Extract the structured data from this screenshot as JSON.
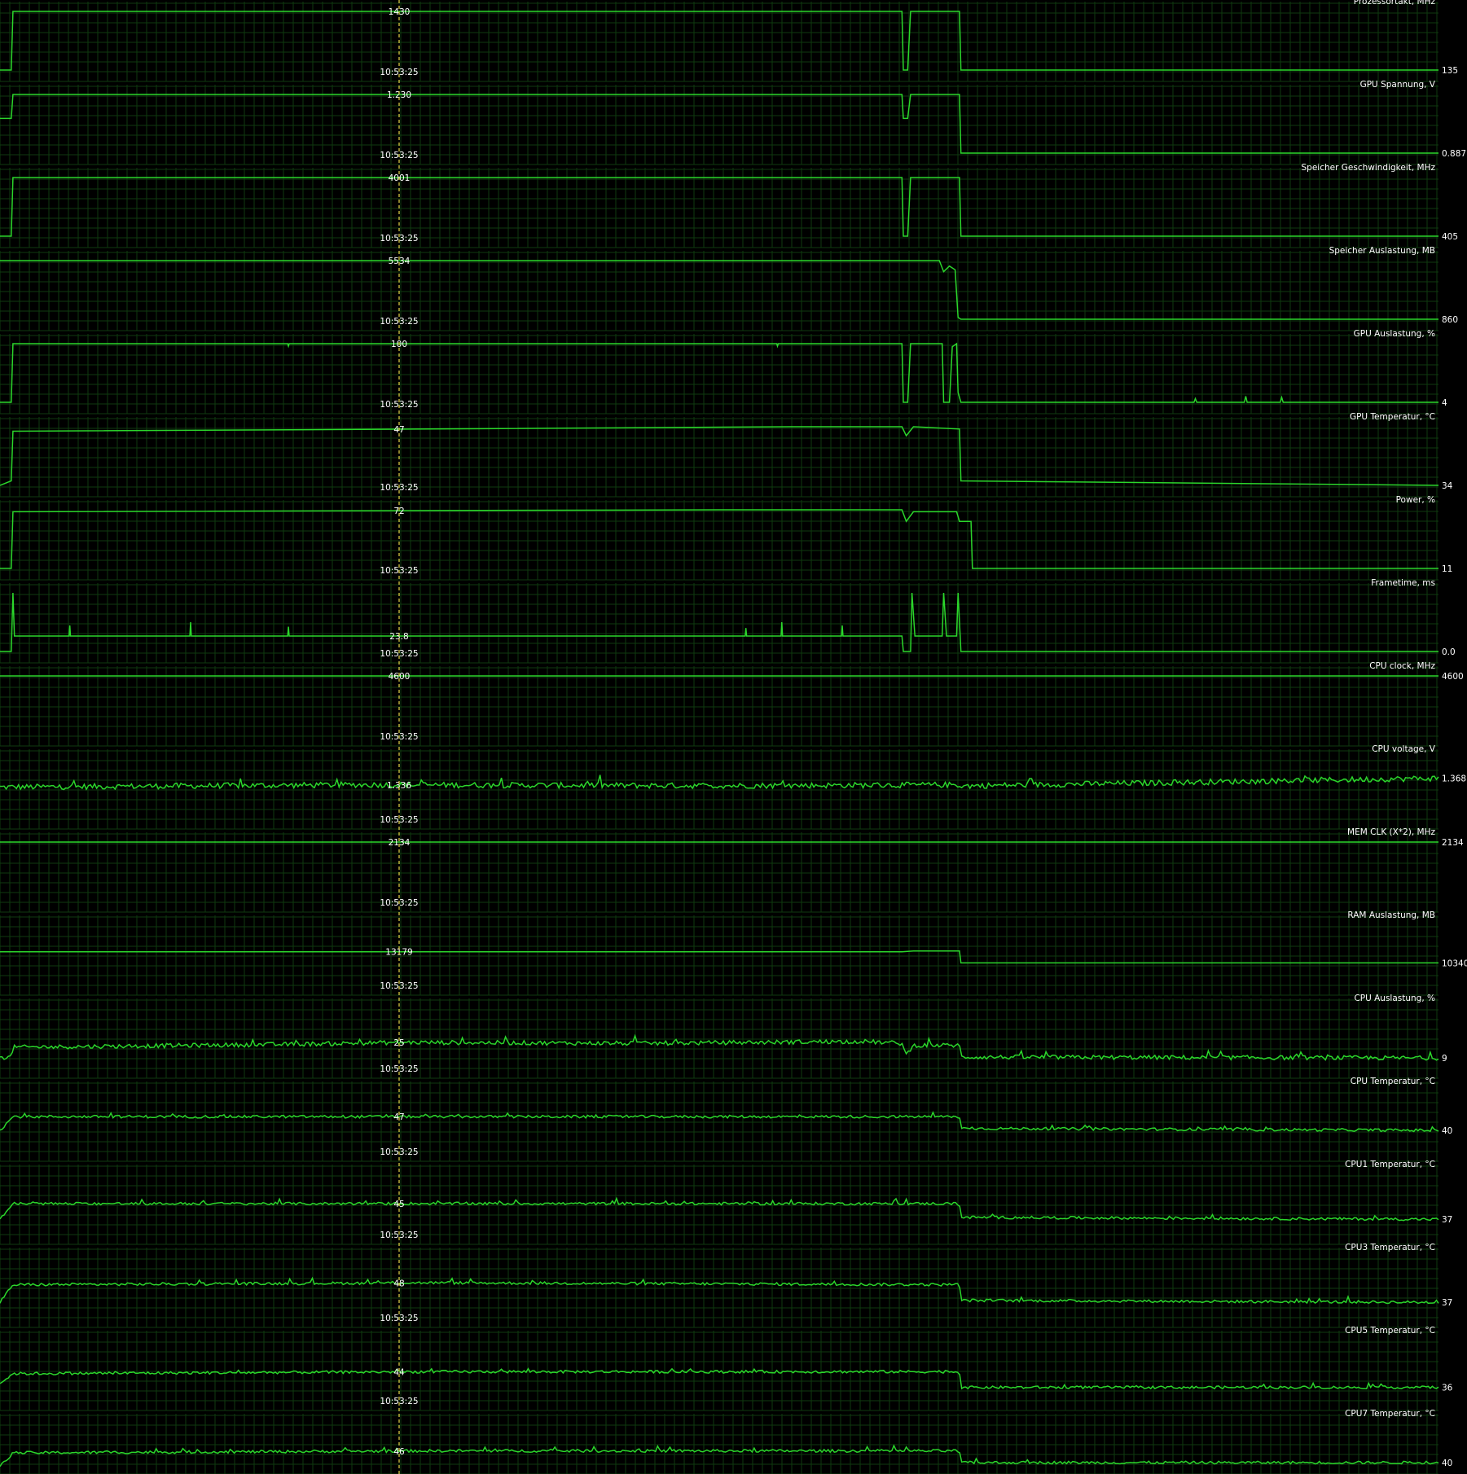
{
  "cursor_time": "10:53:25",
  "colors": {
    "background": "#000000",
    "grid": "#0f3a0f",
    "line": "#2bd62b",
    "text": "#ffffff",
    "cursor": "#e8d84a"
  },
  "panels": [
    {
      "title": "Prozessortakt, MHz",
      "cursor_value": "1430",
      "current_value": "135",
      "ylim": [
        135,
        1430
      ],
      "series": [
        [
          0,
          135
        ],
        [
          0.0078,
          135
        ],
        [
          0.009,
          1430
        ],
        [
          0.627,
          1430
        ],
        [
          0.628,
          135
        ],
        [
          0.631,
          135
        ],
        [
          0.633,
          1430
        ],
        [
          0.667,
          1430
        ],
        [
          0.668,
          135
        ],
        [
          1,
          135
        ]
      ]
    },
    {
      "title": "GPU Spannung, V",
      "cursor_value": "1.230",
      "current_value": "0.887",
      "ylim": [
        0.887,
        1.23
      ],
      "series": [
        [
          0,
          1.09
        ],
        [
          0.0078,
          1.09
        ],
        [
          0.009,
          1.23
        ],
        [
          0.627,
          1.23
        ],
        [
          0.628,
          1.09
        ],
        [
          0.631,
          1.09
        ],
        [
          0.633,
          1.23
        ],
        [
          0.667,
          1.23
        ],
        [
          0.668,
          0.887
        ],
        [
          1,
          0.887
        ]
      ]
    },
    {
      "title": "Speicher Geschwindigkeit, MHz",
      "cursor_value": "4001",
      "current_value": "405",
      "ylim": [
        405,
        4001
      ],
      "series": [
        [
          0,
          405
        ],
        [
          0.0078,
          405
        ],
        [
          0.009,
          4001
        ],
        [
          0.627,
          4001
        ],
        [
          0.628,
          405
        ],
        [
          0.631,
          405
        ],
        [
          0.633,
          4001
        ],
        [
          0.667,
          4001
        ],
        [
          0.668,
          405
        ],
        [
          1,
          405
        ]
      ]
    },
    {
      "title": "Speicher Auslastung, MB",
      "cursor_value": "5534",
      "current_value": "860",
      "ylim": [
        860,
        5534
      ],
      "series": [
        [
          0,
          5534
        ],
        [
          0.653,
          5534
        ],
        [
          0.656,
          4650
        ],
        [
          0.66,
          5100
        ],
        [
          0.664,
          4800
        ],
        [
          0.666,
          1000
        ],
        [
          0.668,
          860
        ],
        [
          1,
          860
        ]
      ]
    },
    {
      "title": "GPU Auslastung, %",
      "cursor_value": "100",
      "current_value": "4",
      "ylim": [
        4,
        100
      ],
      "series": [
        [
          0,
          4
        ],
        [
          0.0078,
          4
        ],
        [
          0.009,
          100
        ],
        [
          0.2,
          100
        ],
        [
          0.2005,
          96
        ],
        [
          0.201,
          100
        ],
        [
          0.54,
          100
        ],
        [
          0.5405,
          96
        ],
        [
          0.541,
          100
        ],
        [
          0.627,
          100
        ],
        [
          0.628,
          4
        ],
        [
          0.631,
          4
        ],
        [
          0.633,
          100
        ],
        [
          0.655,
          100
        ],
        [
          0.656,
          4
        ],
        [
          0.66,
          4
        ],
        [
          0.662,
          95
        ],
        [
          0.665,
          100
        ],
        [
          0.666,
          20
        ],
        [
          0.668,
          4
        ],
        [
          0.7,
          4
        ],
        [
          0.83,
          4
        ],
        [
          0.831,
          10
        ],
        [
          0.832,
          4
        ],
        [
          0.865,
          4
        ],
        [
          0.866,
          14
        ],
        [
          0.867,
          4
        ],
        [
          0.89,
          4
        ],
        [
          0.891,
          12
        ],
        [
          0.892,
          4
        ],
        [
          1,
          4
        ]
      ]
    },
    {
      "title": "GPU Temperatur, °C",
      "cursor_value": "47",
      "current_value": "34",
      "ylim": [
        34,
        47
      ],
      "series": [
        [
          0,
          34
        ],
        [
          0.0078,
          35
        ],
        [
          0.009,
          46
        ],
        [
          0.3,
          46.5
        ],
        [
          0.55,
          47
        ],
        [
          0.627,
          47
        ],
        [
          0.63,
          45
        ],
        [
          0.635,
          47
        ],
        [
          0.667,
          46.5
        ],
        [
          0.668,
          35
        ],
        [
          1,
          34
        ]
      ]
    },
    {
      "title": "Power, %",
      "cursor_value": "72",
      "current_value": "11",
      "ylim": [
        11,
        72
      ],
      "series": [
        [
          0,
          11
        ],
        [
          0.0078,
          11
        ],
        [
          0.009,
          70
        ],
        [
          0.5,
          72
        ],
        [
          0.627,
          72
        ],
        [
          0.63,
          60
        ],
        [
          0.635,
          70
        ],
        [
          0.665,
          70
        ],
        [
          0.667,
          60
        ],
        [
          0.675,
          60
        ],
        [
          0.676,
          11
        ],
        [
          1,
          11
        ]
      ]
    },
    {
      "title": "Frametime, ms",
      "cursor_value": "23.8",
      "current_value": "0.0",
      "ylim": [
        0,
        90
      ],
      "series": [
        [
          0,
          0
        ],
        [
          0.0078,
          0
        ],
        [
          0.009,
          90
        ],
        [
          0.01,
          23.8
        ],
        [
          0.048,
          23.8
        ],
        [
          0.0485,
          40
        ],
        [
          0.049,
          23.8
        ],
        [
          0.132,
          23.8
        ],
        [
          0.1325,
          45
        ],
        [
          0.133,
          23.8
        ],
        [
          0.2,
          23.8
        ],
        [
          0.2005,
          38
        ],
        [
          0.201,
          23.8
        ],
        [
          0.518,
          23.8
        ],
        [
          0.5185,
          36
        ],
        [
          0.519,
          23.8
        ],
        [
          0.543,
          23.8
        ],
        [
          0.5435,
          45
        ],
        [
          0.544,
          23.8
        ],
        [
          0.585,
          23.8
        ],
        [
          0.5855,
          40
        ],
        [
          0.586,
          23.8
        ],
        [
          0.627,
          23.8
        ],
        [
          0.628,
          0
        ],
        [
          0.633,
          0
        ],
        [
          0.634,
          90
        ],
        [
          0.636,
          23.8
        ],
        [
          0.655,
          23.8
        ],
        [
          0.656,
          90
        ],
        [
          0.658,
          23.8
        ],
        [
          0.665,
          23.8
        ],
        [
          0.666,
          90
        ],
        [
          0.668,
          0
        ],
        [
          1,
          0
        ]
      ]
    },
    {
      "title": "CPU clock, MHz",
      "cursor_value": "4600",
      "current_value": "4600",
      "ylim": [
        0,
        4600
      ],
      "series": [
        [
          0,
          4600
        ],
        [
          1,
          4600
        ]
      ]
    },
    {
      "title": "CPU voltage, V",
      "cursor_value": "1.336",
      "current_value": "1.368",
      "ylim": [
        1.2,
        1.45
      ],
      "series": [
        [
          0,
          1.33
        ],
        [
          0.25,
          1.34
        ],
        [
          0.5,
          1.336
        ],
        [
          0.667,
          1.34
        ],
        [
          0.668,
          1.335
        ],
        [
          1,
          1.368
        ]
      ]
    },
    {
      "title": "MEM CLK (X*2), MHz",
      "cursor_value": "2134",
      "current_value": "2134",
      "ylim": [
        0,
        2134
      ],
      "series": [
        [
          0,
          2134
        ],
        [
          1,
          2134
        ]
      ]
    },
    {
      "title": "RAM Auslastung, MB",
      "cursor_value": "13179",
      "current_value": "10340",
      "ylim": [
        5000,
        20000
      ],
      "series": [
        [
          0,
          13179
        ],
        [
          0.627,
          13179
        ],
        [
          0.635,
          13400
        ],
        [
          0.667,
          13400
        ],
        [
          0.668,
          10340
        ],
        [
          1,
          10340
        ]
      ]
    },
    {
      "title": "CPU Auslastung, %",
      "cursor_value": "25",
      "current_value": "9",
      "ylim": [
        0,
        60
      ],
      "series": [
        [
          0,
          9
        ],
        [
          0.0078,
          10
        ],
        [
          0.009,
          20
        ],
        [
          0.2,
          23
        ],
        [
          0.28,
          25
        ],
        [
          0.45,
          24
        ],
        [
          0.6,
          26
        ],
        [
          0.627,
          24
        ],
        [
          0.63,
          12
        ],
        [
          0.635,
          22
        ],
        [
          0.667,
          22
        ],
        [
          0.668,
          10
        ],
        [
          1,
          9
        ]
      ]
    },
    {
      "title": "CPU Temperatur, °C",
      "cursor_value": "47",
      "current_value": "40",
      "ylim": [
        30,
        60
      ],
      "series": [
        [
          0,
          40
        ],
        [
          0.009,
          47
        ],
        [
          0.3,
          47
        ],
        [
          0.667,
          47
        ],
        [
          0.668,
          41
        ],
        [
          1,
          40
        ]
      ]
    },
    {
      "title": "CPU1 Temperatur, °C",
      "cursor_value": "45",
      "current_value": "37",
      "ylim": [
        30,
        60
      ],
      "series": [
        [
          0,
          37
        ],
        [
          0.009,
          45
        ],
        [
          0.3,
          45
        ],
        [
          0.667,
          45
        ],
        [
          0.668,
          38
        ],
        [
          1,
          37
        ]
      ]
    },
    {
      "title": "CPU3 Temperatur, °C",
      "cursor_value": "48",
      "current_value": "37",
      "ylim": [
        30,
        60
      ],
      "series": [
        [
          0,
          37
        ],
        [
          0.009,
          46
        ],
        [
          0.3,
          47
        ],
        [
          0.667,
          46
        ],
        [
          0.668,
          38
        ],
        [
          1,
          37
        ]
      ]
    },
    {
      "title": "CPU5 Temperatur, °C",
      "cursor_value": "44",
      "current_value": "36",
      "ylim": [
        30,
        60
      ],
      "series": [
        [
          0,
          38
        ],
        [
          0.009,
          43
        ],
        [
          0.3,
          44
        ],
        [
          0.667,
          44
        ],
        [
          0.668,
          36
        ],
        [
          1,
          36
        ]
      ]
    },
    {
      "title": "CPU7 Temperatur, °C",
      "cursor_value": "46",
      "current_value": "40",
      "ylim": [
        30,
        60
      ],
      "series": [
        [
          0,
          38
        ],
        [
          0.009,
          45
        ],
        [
          0.3,
          46
        ],
        [
          0.667,
          46
        ],
        [
          0.668,
          40
        ],
        [
          1,
          40
        ]
      ]
    }
  ]
}
